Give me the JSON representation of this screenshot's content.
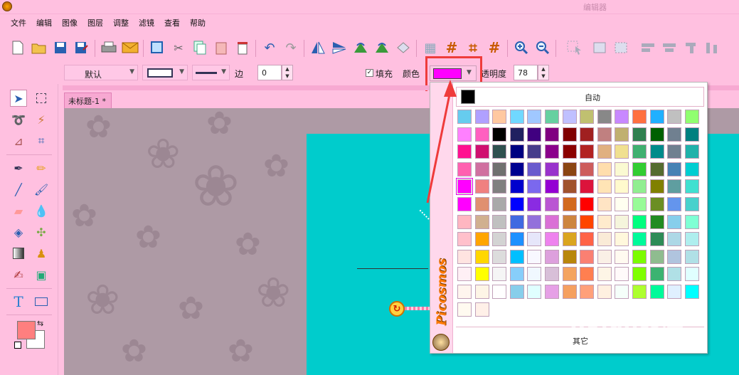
{
  "window": {
    "title": "编辑器"
  },
  "menu": [
    "文件",
    "编辑",
    "图像",
    "图层",
    "调整",
    "滤镜",
    "查看",
    "帮助"
  ],
  "options": {
    "font_preset": "默认",
    "border_label": "边",
    "border_value": "0",
    "fill_label": "填充",
    "fill_checked": "✓",
    "color_label": "颜色",
    "opacity_label": "透明度",
    "opacity_value": "78",
    "current_color": "#ff00ff"
  },
  "tab": {
    "label": "未标题-1 *"
  },
  "palette": {
    "brand": "Picosmos",
    "auto_label": "自动",
    "auto_color": "#000000",
    "more_label": "其它",
    "selected": {
      "row": 4,
      "col": 0
    },
    "rows": [
      [
        "#66ccee",
        "#b0a0ff",
        "#ffc8a0",
        "#70d8ff",
        "#a0c8ff",
        "#66d0a0",
        "#c0c0ff",
        "#c0c070",
        "#888888",
        "#c888ff",
        "#ff7040",
        "#20b0ff",
        "#c0c0c0",
        "#90ff70"
      ],
      [
        "#ff80ff",
        "#ff60c0",
        "#000000",
        "#202060",
        "#400080",
        "#800080",
        "#800000",
        "#a02020",
        "#c08080",
        "#c0b070",
        "#308050",
        "#006000",
        "#708090",
        "#008080"
      ],
      [
        "#ff1090",
        "#d01070",
        "#305050",
        "#000080",
        "#483d8b",
        "#8b008b",
        "#8b0000",
        "#b22222",
        "#e0b080",
        "#f0e090",
        "#40b070",
        "#008b8b",
        "#708090",
        "#20b2aa"
      ],
      [
        "#ff60b0",
        "#d070a0",
        "#707070",
        "#000090",
        "#6a5acd",
        "#9932cc",
        "#8b4513",
        "#cd5c5c",
        "#ffdead",
        "#fafad2",
        "#32cd32",
        "#556b2f",
        "#4682b4",
        "#00ced1"
      ],
      [
        "#ff00ff",
        "#f08080",
        "#808080",
        "#0000cd",
        "#7b68ee",
        "#9400d3",
        "#a0522d",
        "#dc143c",
        "#ffe4b5",
        "#fffacd",
        "#90ee90",
        "#808000",
        "#5f9ea0",
        "#40e0d0"
      ],
      [
        "#ff00ff",
        "#e09070",
        "#a9a9a9",
        "#0000ff",
        "#8a2be2",
        "#ba55d3",
        "#d2691e",
        "#ff0000",
        "#ffe4c4",
        "#fffff0",
        "#98fb98",
        "#6b8e23",
        "#6495ed",
        "#48d1cc"
      ],
      [
        "#ffb6c1",
        "#d0b090",
        "#c0c0c0",
        "#4169e1",
        "#9370db",
        "#da70d6",
        "#cd853f",
        "#ff4500",
        "#ffebcd",
        "#f5f5dc",
        "#00ff7f",
        "#228b22",
        "#87ceeb",
        "#7fffd4"
      ],
      [
        "#ffc0cb",
        "#ffa500",
        "#d3d3d3",
        "#1e90ff",
        "#e6e6fa",
        "#ee82ee",
        "#daa520",
        "#ff6347",
        "#faebd7",
        "#fff8dc",
        "#00fa9a",
        "#2e8b57",
        "#add8e6",
        "#afeeee"
      ],
      [
        "#ffe4e1",
        "#ffd700",
        "#dcdcdc",
        "#00bfff",
        "#f8f8ff",
        "#dda0dd",
        "#b8860b",
        "#fa8072",
        "#faf0e6",
        "#fffaf0",
        "#7cfc00",
        "#8fbc8f",
        "#b0c4de",
        "#b0e0e6"
      ],
      [
        "#fff0f5",
        "#ffff00",
        "#f5f5f5",
        "#87cefa",
        "#f0f8ff",
        "#d8bfd8",
        "#f4a460",
        "#ff7f50",
        "#fdf5e6",
        "#fffafa",
        "#7fff00",
        "#3cb371",
        "#b0e0e6",
        "#e0ffff"
      ],
      [
        "#fff5ee",
        "#fdf5e6",
        "#ffffff",
        "#87ceeb",
        "#e0ffff",
        "#e6a0e6",
        "#f5a060",
        "#ffa07a",
        "#fff0e0",
        "#f5fffa",
        "#adff2f",
        "#00fa9a",
        "#e0f0ff",
        "#00ffff"
      ],
      [
        "#fffaf0",
        "#fff0e8"
      ]
    ]
  },
  "colors": {
    "foreground": "#ff7f7f",
    "background": "#ffffff",
    "canvas": "#00cccc"
  },
  "watermark": {
    "text": "Baidu经验",
    "url": "jingyan.baidu.com"
  }
}
